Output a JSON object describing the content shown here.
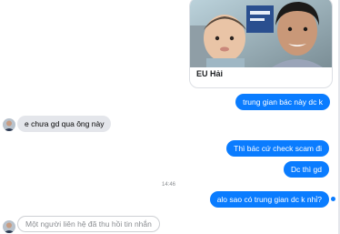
{
  "shared_card": {
    "caption": "EU Hải"
  },
  "messages": [
    {
      "id": "m1",
      "sender": "me",
      "text": "trung gian bác này dc k"
    },
    {
      "id": "m2",
      "sender": "other",
      "text": "e chưa gd qua ông này"
    },
    {
      "id": "m3",
      "sender": "me",
      "text": "Thì bác cứ check scam đi"
    },
    {
      "id": "m4",
      "sender": "me",
      "text": "Dc thì gd"
    },
    {
      "id": "m5",
      "sender": "me",
      "text": "alo sao có trung gian dc k nhỉ?"
    },
    {
      "id": "m6",
      "sender": "other",
      "text": "Một người liên hệ đã thu hồi tin nhắn",
      "recalled": true
    }
  ],
  "timestamp": "14:46",
  "colors": {
    "outgoing": "#0a7cff",
    "incoming": "#e4e6eb",
    "text_muted": "#8a8d91"
  }
}
